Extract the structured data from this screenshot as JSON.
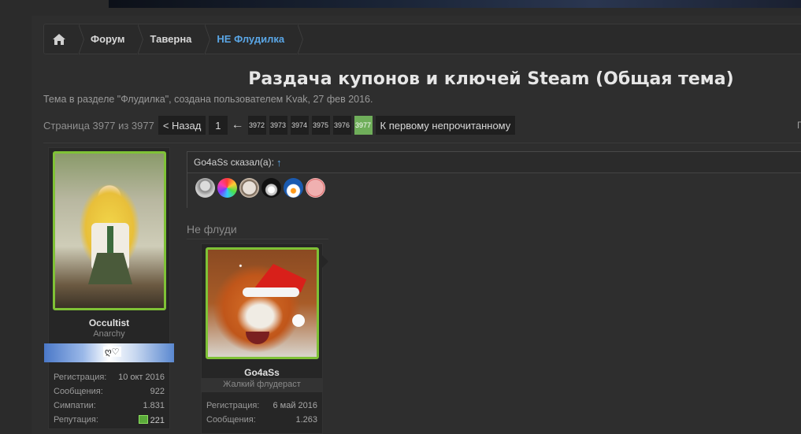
{
  "breadcrumb": {
    "items": [
      {
        "label": "Форум"
      },
      {
        "label": "Таверна"
      },
      {
        "label": "НЕ Флудилка"
      }
    ]
  },
  "thread": {
    "title": "Раздача купонов и ключей Steam (Общая тема)",
    "meta": "Тема в разделе \"Флудилка\", создана пользователем Kvak, 27 фев 2016."
  },
  "pagination": {
    "label": "Страница 3977 из 3977",
    "prev": "< Назад",
    "first": "1",
    "ellipsis_arrow": "←",
    "pages": [
      "3972",
      "3973",
      "3974",
      "3975",
      "3976"
    ],
    "current": "3977",
    "unread": "К первому непрочитанному",
    "right_cut": "Г"
  },
  "post_user": {
    "name": "Occultist",
    "title": "Anarchy",
    "banner_text": "ღ♡",
    "stats": [
      {
        "label": "Регистрация:",
        "value": "10 окт 2016"
      },
      {
        "label": "Сообщения:",
        "value": "922"
      },
      {
        "label": "Симпатии:",
        "value": "1.831"
      },
      {
        "label": "Репутация:",
        "value": "221"
      }
    ]
  },
  "quote": {
    "header": "Go4aSs сказал(а):",
    "up_arrow": "↑",
    "emoji_icons": [
      "old-woman-icon",
      "rainbow-face-icon",
      "cat-face-icon",
      "screaming-face-icon",
      "penguin-icon",
      "pink-blob-icon"
    ]
  },
  "section_note": "Не флуди",
  "quoted_user": {
    "name": "Go4aSs",
    "title": "Жалкий флудераст",
    "stats": [
      {
        "label": "Регистрация:",
        "value": "6 май 2016"
      },
      {
        "label": "Сообщения:",
        "value": "1.263"
      }
    ]
  },
  "colors": {
    "accent_link": "#5aa6e6",
    "avatar_border": "#7fc236",
    "current_page": "#6fae5a"
  }
}
